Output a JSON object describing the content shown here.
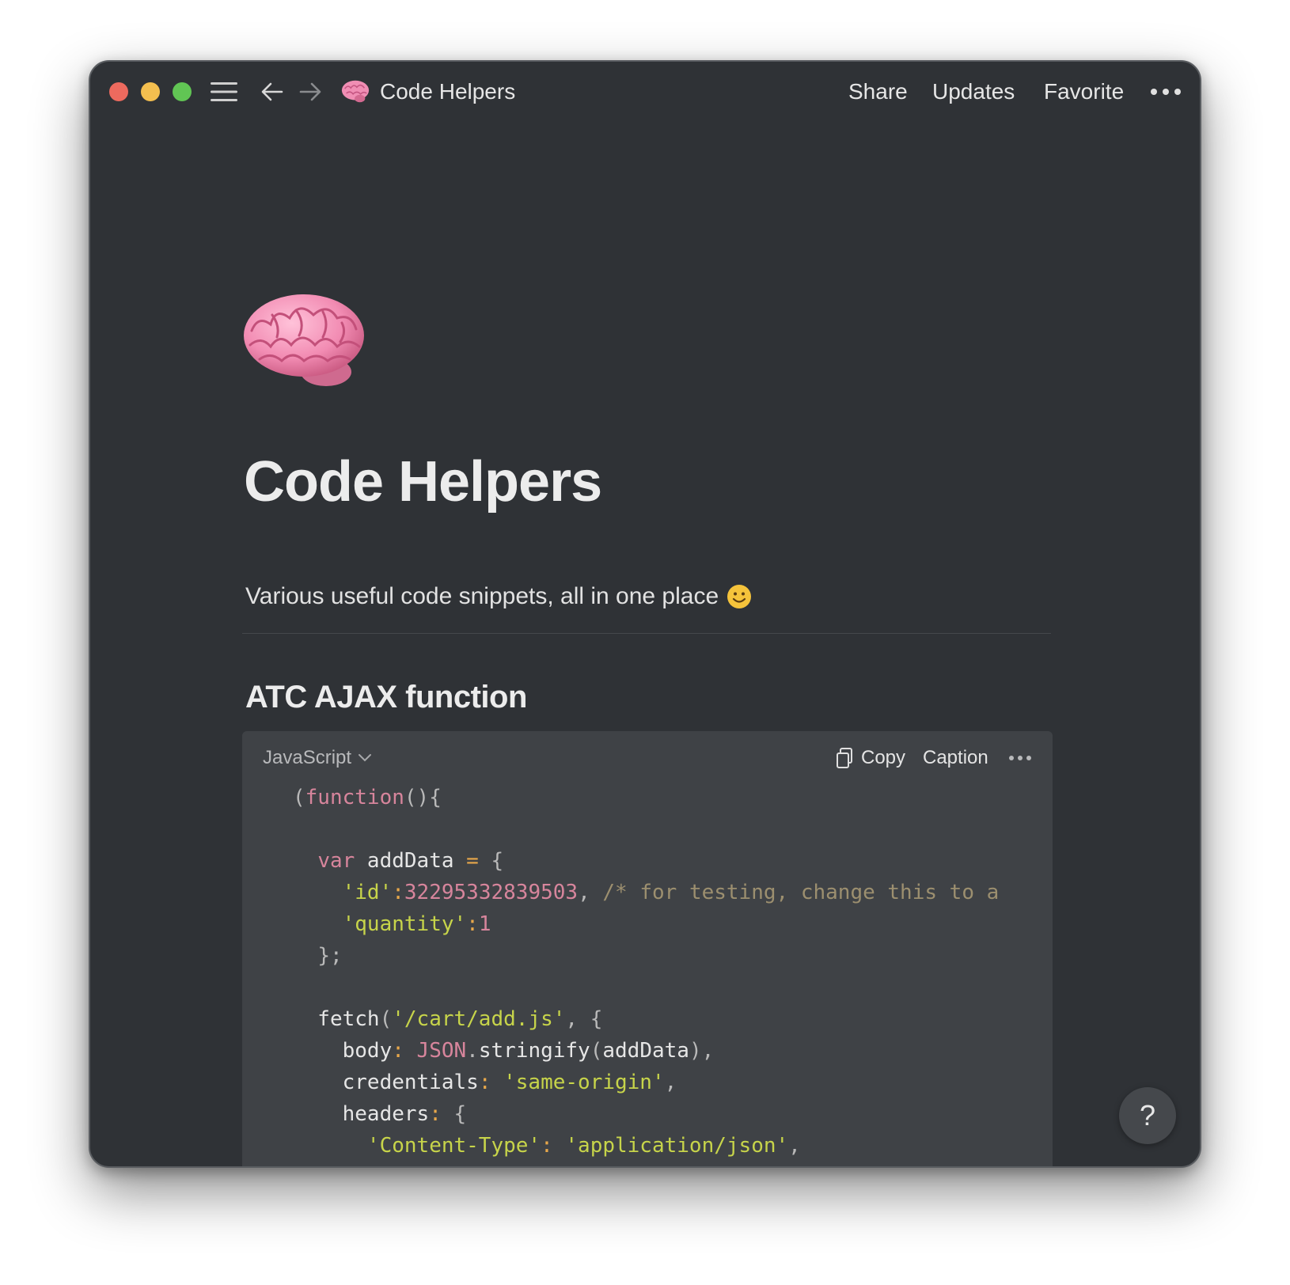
{
  "titlebar": {
    "page_icon": "brain-icon",
    "title": "Code Helpers",
    "share_label": "Share",
    "updates_label": "Updates",
    "favorite_label": "Favorite"
  },
  "page": {
    "icon": "brain-icon",
    "title": "Code Helpers",
    "subtitle": "Various useful code snippets, all in one place",
    "subtitle_icon": "smiling-face-icon"
  },
  "section": {
    "heading": "ATC AJAX function"
  },
  "code_block": {
    "language": "JavaScript",
    "copy_label": "Copy",
    "caption_label": "Caption",
    "lines": [
      "(function(){",
      "",
      "  var addData = {",
      "    'id':32295332839503, /* for testing, change this to a",
      "    'quantity':1",
      "  };",
      "",
      "  fetch('/cart/add.js', {",
      "    body: JSON.stringify(addData),",
      "    credentials: 'same-origin',",
      "    headers: {",
      "      'Content-Type': 'application/json',"
    ]
  },
  "help": {
    "label": "?"
  },
  "colors": {
    "background": "#2f3236",
    "code_background": "#3f4246",
    "keyword": "#d7859c",
    "string": "#c7d44a",
    "comment": "#9c8f6f"
  }
}
